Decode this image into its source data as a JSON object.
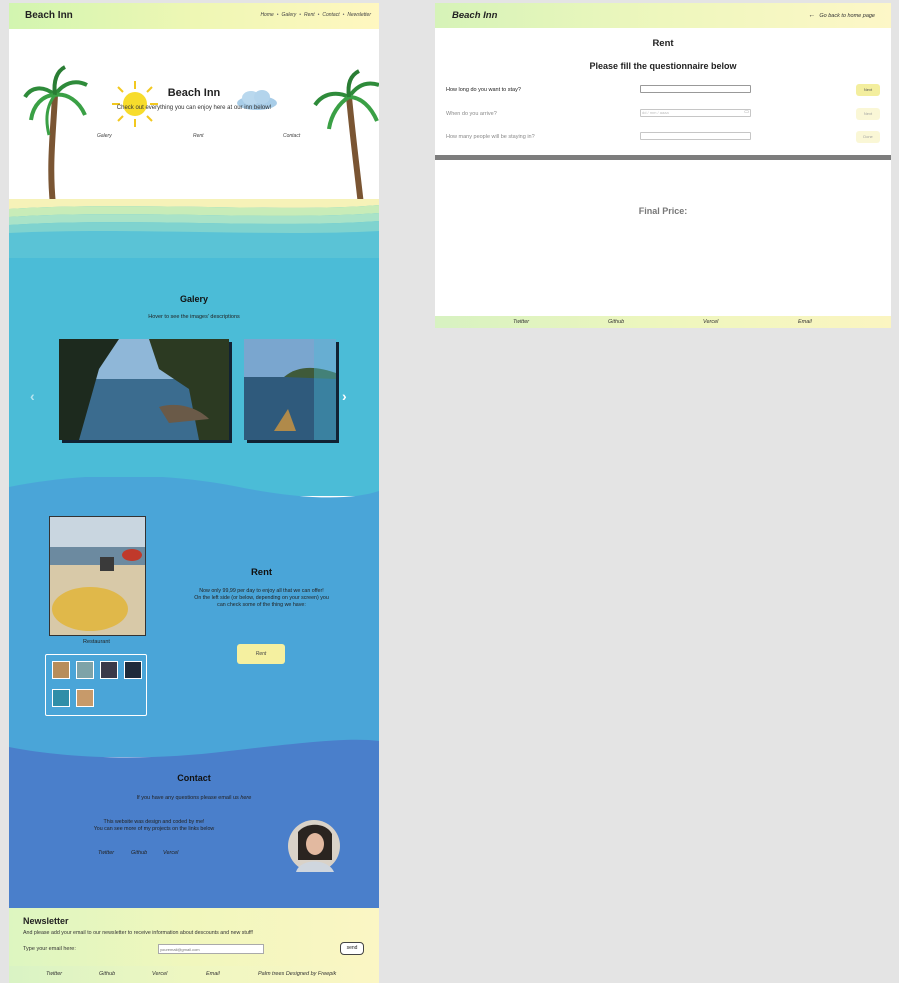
{
  "home": {
    "header": {
      "brand": "Beach Inn",
      "nav": [
        "Home",
        "Galery",
        "Rent",
        "Contact",
        "Newsletter"
      ]
    },
    "hero": {
      "title": "Beach Inn",
      "subtitle": "Check out everything you can enjoy here at our inn below!",
      "links": [
        "Galery",
        "Rent",
        "Contact"
      ]
    },
    "galery": {
      "title": "Galery",
      "subtitle": "Hover to see the images' descriptions",
      "prev_icon": "chevron-left-icon",
      "next_icon": "chevron-right-icon"
    },
    "rent": {
      "title": "Rent",
      "description_lines": [
        "Now only 99,99 per day to enjoy all that we can offer!",
        "On the left side (or below, depending on your screen) you",
        "can check some of the thing we have:"
      ],
      "button": "Rent",
      "caption": "Restaurant"
    },
    "contact": {
      "title": "Contact",
      "email_text": "If you have any questions please email us",
      "email_link": "here",
      "credit_lines": [
        "This website was design and coded by me!",
        "You can see more of my projects on the links below"
      ],
      "links": [
        "Twitter",
        "Github",
        "Vercel"
      ]
    },
    "newsletter": {
      "title": "Newsletter",
      "subtitle": "And please add your email to our newsletter to receive information about descounts and new stuff!",
      "label": "Type your email here:",
      "placeholder": "youremail@gmail.com",
      "button": "send"
    },
    "footer": [
      "Twitter",
      "Github",
      "Vercel",
      "Email",
      "Palm trees Designed by Freepik"
    ]
  },
  "rent_page": {
    "header": {
      "brand": "Beach Inn",
      "back": "Go back to home page",
      "back_icon": "arrow-left-icon"
    },
    "title": "Rent",
    "subtitle": "Please fill the questionnaire below",
    "questions": [
      {
        "label": "How long do you want to stay?",
        "placeholder": "",
        "button": "Next"
      },
      {
        "label": "When do you arrive?",
        "placeholder": "dd / mm / aaaa",
        "button": "Next"
      },
      {
        "label": "How many people will be staying in?",
        "placeholder": "",
        "button": "Done"
      }
    ],
    "final_price": "Final Price:",
    "footer": [
      "Twitter",
      "Github",
      "Vercel",
      "Email"
    ]
  },
  "colors": {
    "sea_light": "#4bbcd7",
    "sea_mid": "#4aa5d8",
    "sea_deep": "#4a7fcb",
    "button_yellow": "#f5f0a0"
  }
}
